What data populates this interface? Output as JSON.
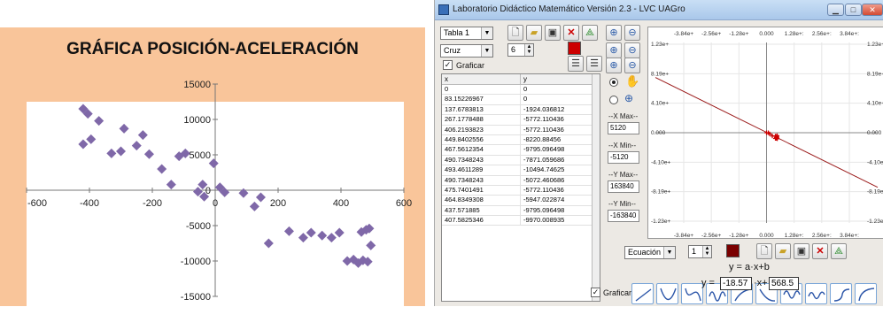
{
  "excel": {
    "title": "GRÁFICA POSICIÓN-ACELERACIÓN",
    "x_tick_labels": [
      "-600",
      "-400",
      "-200",
      "0",
      "200",
      "400",
      "600"
    ],
    "y_tick_labels": [
      "15000",
      "10000",
      "5000",
      "0",
      "-5000",
      "-10000",
      "-15000"
    ]
  },
  "chart_data": {
    "type": "scatter",
    "title": "GRÁFICA POSICIÓN-ACELERACIÓN",
    "xlim": [
      -600,
      600
    ],
    "ylim": [
      -15000,
      15000
    ],
    "grid": false,
    "marker_color": "#7f68a8",
    "x": [
      -420,
      -405,
      -420,
      -395,
      -370,
      -330,
      -300,
      -290,
      -250,
      -230,
      -210,
      -170,
      -140,
      -115,
      -95,
      -55,
      -40,
      -35,
      -5,
      15,
      30,
      90,
      125,
      145,
      170,
      235,
      280,
      305,
      340,
      370,
      395,
      420,
      440,
      455,
      465,
      470,
      480,
      485,
      490,
      495
    ],
    "y": [
      11500,
      10800,
      6500,
      7200,
      9800,
      5200,
      5500,
      8700,
      6300,
      7800,
      5100,
      3000,
      800,
      4800,
      5200,
      -200,
      800,
      -900,
      3800,
      400,
      -300,
      -400,
      -2300,
      -1000,
      -7500,
      -5800,
      -6700,
      -6000,
      -6400,
      -6700,
      -6000,
      -10000,
      -9800,
      -10300,
      -5900,
      -9900,
      -5600,
      -10100,
      -5400,
      -7800
    ]
  },
  "app": {
    "window_title": "Laboratorio Didáctico Matemático Versión 2.3 - LVC UAGro",
    "table_select": "Tabla 1",
    "marker_select": "Cruz",
    "marker_size": "6",
    "graph_checkbox_label": "Graficar",
    "table": {
      "headers": [
        "x",
        "y"
      ],
      "rows": [
        [
          "0",
          "0"
        ],
        [
          "83.15226967",
          "0"
        ],
        [
          "137.6783813",
          "-1924.036812"
        ],
        [
          "267.1778488",
          "-5772.110436"
        ],
        [
          "406.2193823",
          "-5772.110436"
        ],
        [
          "449.8402556",
          "-8220.88456"
        ],
        [
          "467.5612354",
          "-9795.096498"
        ],
        [
          "490.7348243",
          "-7871.059686"
        ],
        [
          "493.4611289",
          "-10494.74625"
        ],
        [
          "490.7348243",
          "-5072.460686"
        ],
        [
          "475.7401491",
          "-5772.110436"
        ],
        [
          "464.8349308",
          "-5947.022874"
        ],
        [
          "437.571885",
          "-9795.096498"
        ],
        [
          "407.5825346",
          "-9970.008935"
        ]
      ]
    },
    "limits": {
      "x_max_label": "--X Max--",
      "x_max": "5120",
      "x_min_label": "--X Min--",
      "x_min": "-5120",
      "y_max_label": "--Y Max--",
      "y_max": "163840",
      "y_min_label": "--Y Min--",
      "y_min": "-163840"
    },
    "graph": {
      "x_labels_top": [
        "-3.84e+",
        "-2.56e+",
        "-1.28e+",
        "0.000",
        "1.28e+:",
        "2.56e+:",
        "3.84e+:"
      ],
      "x_labels_bottom": [
        "-3.84e+",
        "-2.56e+",
        "-1.28e+",
        "0.000",
        "1.28e+:",
        "2.56e+:",
        "3.84e+:"
      ],
      "y_labels_left": [
        "1.23e+",
        "8.19e+",
        "4.10e+",
        "0.000",
        "-4.10e+",
        "-8.19e+",
        "-1.23e+"
      ],
      "y_labels_right": [
        "1.23e+",
        "8.19e+",
        "4.10e+",
        "0.000",
        "-4.10e+",
        "-8.19e+",
        "-1.23e+"
      ],
      "line_color": "#9b1b1b",
      "point_color": "#cc0000"
    },
    "equation_select": "Ecuación 1",
    "equation_size": "1",
    "equation_checkbox_label": "Graficar",
    "equation_general": "y = a·x+b",
    "equation_prefix": "y =",
    "coef_a": "-18.57",
    "coef_mid": "·x+",
    "coef_b": "568.5"
  }
}
